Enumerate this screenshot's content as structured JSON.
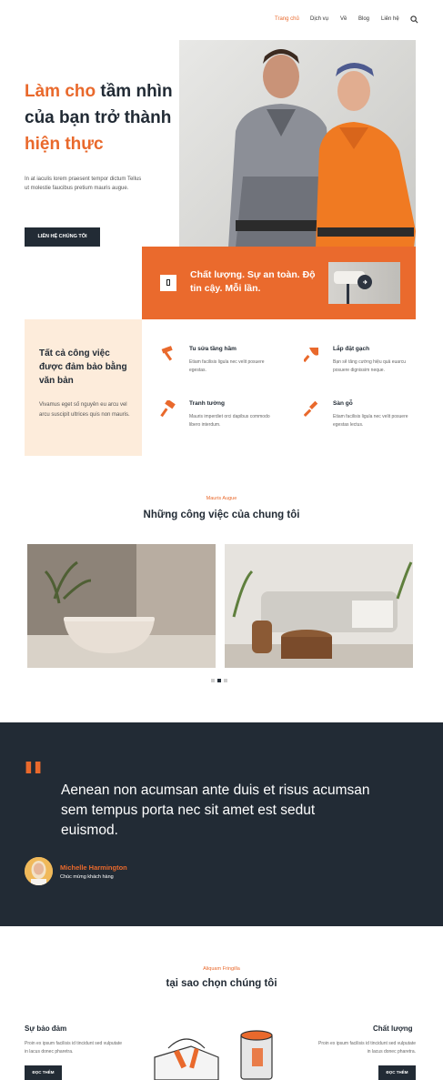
{
  "nav": {
    "items": [
      "Trang chủ",
      "Dịch vụ",
      "Về",
      "Blog",
      "Liên hệ"
    ],
    "search_icon": "search-icon"
  },
  "hero": {
    "title_part1": "Làm cho",
    "title_part2": " tầm nhìn của bạn trở thành ",
    "title_part3": "hiện thực",
    "description": "In at iaculis lorem praesent tempor dictum Tellus ut molestie faucibus pretium mauris augue.",
    "button": "LIÊN HỆ CHÚNG TÔI"
  },
  "quality": {
    "text": "Chất lượng. Sự an toàn. Độ tin cậy. Mỗi lần."
  },
  "panel": {
    "title": "Tất cả công việc được đảm bảo bằng văn bản",
    "description": "Vivamus eget số nguyên eu arcu vel arcu suscipit ultrices quis non mauris."
  },
  "services": [
    {
      "title": "Tu sửa tầng hầm",
      "description": "Etiam facilisis ligula nec velit posuere egestas.",
      "icon": "hammer-icon"
    },
    {
      "title": "Lắp đặt gạch",
      "description": "Bạn sẽ tăng cường hiệu quả euarcu posuere dignissim neque.",
      "icon": "trowel-icon"
    },
    {
      "title": "Tranh tường",
      "description": "Mauris imperdiet orci dapibus commodo libero interdum.",
      "icon": "paint-roller-icon"
    },
    {
      "title": "Sàn gỗ",
      "description": "Etiam facilisis ligula nec velit posuere egestas lectus.",
      "icon": "brush-icon"
    }
  ],
  "projects": {
    "eyebrow": "Mauris Augue",
    "title": "Những công việc của chung tôi"
  },
  "testimonial": {
    "quote_mark": "\"",
    "quote": "Aenean non acumsan ante duis et risus acumsan sem tempus porta nec sit amet est sedut euismod.",
    "author": "Michelle Harmington",
    "role": "Chúc mừng khách hàng"
  },
  "why": {
    "eyebrow": "Aliquam Fringilla",
    "title": "tại sao chọn chúng tôi",
    "left_title": "Sự bảo đảm",
    "left_description": "Proin ex ipsum facilisis id tincidunt sed vulputate in lacus donec pharetra.",
    "left_button": "ĐỌC THÊM",
    "right_title": "Chất lượng",
    "right_description": "Proin ex ipsum facilisis id tincidunt sed vulputate in lacus donec pharetra.",
    "right_button": "ĐỌC THÊM"
  },
  "colors": {
    "accent": "#e9692c",
    "dark": "#222b35",
    "panel": "#fdecdb"
  }
}
